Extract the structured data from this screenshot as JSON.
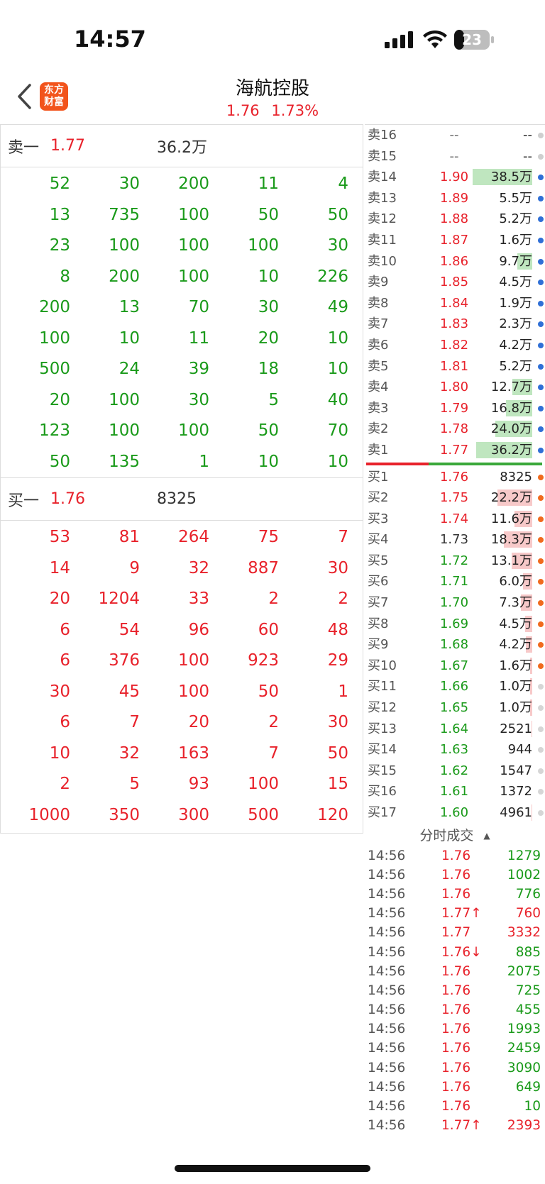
{
  "status": {
    "time": "14:57",
    "battery": "23"
  },
  "nav": {
    "logo_line1": "东方",
    "logo_line2": "财富",
    "stock_name": "海航控股",
    "price": "1.76",
    "change_pct": "1.73%"
  },
  "sell_one": {
    "label": "卖一",
    "price": "1.77",
    "volume": "36.2万"
  },
  "sell_grid": [
    [
      "52",
      "30",
      "200",
      "11",
      "4"
    ],
    [
      "13",
      "735",
      "100",
      "50",
      "50"
    ],
    [
      "23",
      "100",
      "100",
      "100",
      "30"
    ],
    [
      "8",
      "200",
      "100",
      "10",
      "226"
    ],
    [
      "200",
      "13",
      "70",
      "30",
      "49"
    ],
    [
      "100",
      "10",
      "11",
      "20",
      "10"
    ],
    [
      "500",
      "24",
      "39",
      "18",
      "10"
    ],
    [
      "20",
      "100",
      "30",
      "5",
      "40"
    ],
    [
      "123",
      "100",
      "100",
      "50",
      "70"
    ],
    [
      "50",
      "135",
      "1",
      "10",
      "10"
    ]
  ],
  "buy_one": {
    "label": "买一",
    "price": "1.76",
    "volume": "8325"
  },
  "buy_grid": [
    [
      "53",
      "81",
      "264",
      "75",
      "7"
    ],
    [
      "14",
      "9",
      "32",
      "887",
      "30"
    ],
    [
      "20",
      "1204",
      "33",
      "2",
      "2"
    ],
    [
      "6",
      "54",
      "96",
      "60",
      "48"
    ],
    [
      "6",
      "376",
      "100",
      "923",
      "29"
    ],
    [
      "30",
      "45",
      "100",
      "50",
      "1"
    ],
    [
      "6",
      "7",
      "20",
      "2",
      "30"
    ],
    [
      "10",
      "32",
      "163",
      "7",
      "50"
    ],
    [
      "2",
      "5",
      "93",
      "100",
      "15"
    ],
    [
      "1000",
      "350",
      "300",
      "500",
      "120"
    ]
  ],
  "asks": [
    {
      "label": "卖16",
      "price": "--",
      "volume": "--",
      "price_color": "gray",
      "bar": 0,
      "dot": "#cfcfcf"
    },
    {
      "label": "卖15",
      "price": "--",
      "volume": "--",
      "price_color": "gray",
      "bar": 0,
      "dot": "#cfcfcf"
    },
    {
      "label": "卖14",
      "price": "1.90",
      "volume": "38.5万",
      "price_color": "red",
      "bar": 1.0,
      "dot": "#2f6fd6"
    },
    {
      "label": "卖13",
      "price": "1.89",
      "volume": "5.5万",
      "price_color": "red",
      "bar": 0.0,
      "dot": "#2f6fd6"
    },
    {
      "label": "卖12",
      "price": "1.88",
      "volume": "5.2万",
      "price_color": "red",
      "bar": 0.0,
      "dot": "#2f6fd6"
    },
    {
      "label": "卖11",
      "price": "1.87",
      "volume": "1.6万",
      "price_color": "red",
      "bar": 0.0,
      "dot": "#2f6fd6"
    },
    {
      "label": "卖10",
      "price": "1.86",
      "volume": "9.7万",
      "price_color": "red",
      "bar": 0.25,
      "dot": "#2f6fd6"
    },
    {
      "label": "卖9",
      "price": "1.85",
      "volume": "4.5万",
      "price_color": "red",
      "bar": 0.0,
      "dot": "#2f6fd6"
    },
    {
      "label": "卖8",
      "price": "1.84",
      "volume": "1.9万",
      "price_color": "red",
      "bar": 0.0,
      "dot": "#2f6fd6"
    },
    {
      "label": "卖7",
      "price": "1.83",
      "volume": "2.3万",
      "price_color": "red",
      "bar": 0.0,
      "dot": "#2f6fd6"
    },
    {
      "label": "卖6",
      "price": "1.82",
      "volume": "4.2万",
      "price_color": "red",
      "bar": 0.0,
      "dot": "#2f6fd6"
    },
    {
      "label": "卖5",
      "price": "1.81",
      "volume": "5.2万",
      "price_color": "red",
      "bar": 0.0,
      "dot": "#2f6fd6"
    },
    {
      "label": "卖4",
      "price": "1.80",
      "volume": "12.7万",
      "price_color": "red",
      "bar": 0.33,
      "dot": "#2f6fd6"
    },
    {
      "label": "卖3",
      "price": "1.79",
      "volume": "16.8万",
      "price_color": "red",
      "bar": 0.44,
      "dot": "#2f6fd6"
    },
    {
      "label": "卖2",
      "price": "1.78",
      "volume": "24.0万",
      "price_color": "red",
      "bar": 0.62,
      "dot": "#2f6fd6"
    },
    {
      "label": "卖1",
      "price": "1.77",
      "volume": "36.2万",
      "price_color": "red",
      "bar": 0.94,
      "dot": "#2f6fd6"
    }
  ],
  "bids": [
    {
      "label": "买1",
      "price": "1.76",
      "volume": "8325",
      "price_color": "red",
      "bar": 0.0,
      "dot": "#f06a1d"
    },
    {
      "label": "买2",
      "price": "1.75",
      "volume": "22.2万",
      "price_color": "red",
      "bar": 0.58,
      "dot": "#f06a1d"
    },
    {
      "label": "买3",
      "price": "1.74",
      "volume": "11.6万",
      "price_color": "red",
      "bar": 0.3,
      "dot": "#f06a1d"
    },
    {
      "label": "买4",
      "price": "1.73",
      "volume": "18.3万",
      "price_color": "dark",
      "bar": 0.48,
      "dot": "#f06a1d"
    },
    {
      "label": "买5",
      "price": "1.72",
      "volume": "13.1万",
      "price_color": "green",
      "bar": 0.34,
      "dot": "#f06a1d"
    },
    {
      "label": "买6",
      "price": "1.71",
      "volume": "6.0万",
      "price_color": "green",
      "bar": 0.16,
      "dot": "#f06a1d"
    },
    {
      "label": "买7",
      "price": "1.70",
      "volume": "7.3万",
      "price_color": "green",
      "bar": 0.19,
      "dot": "#f06a1d"
    },
    {
      "label": "买8",
      "price": "1.69",
      "volume": "4.5万",
      "price_color": "green",
      "bar": 0.12,
      "dot": "#f06a1d"
    },
    {
      "label": "买9",
      "price": "1.68",
      "volume": "4.2万",
      "price_color": "green",
      "bar": 0.11,
      "dot": "#f06a1d"
    },
    {
      "label": "买10",
      "price": "1.67",
      "volume": "1.6万",
      "price_color": "green",
      "bar": 0.04,
      "dot": "#f06a1d"
    },
    {
      "label": "买11",
      "price": "1.66",
      "volume": "1.0万",
      "price_color": "green",
      "bar": 0.03,
      "dot": "#d6d6d6"
    },
    {
      "label": "买12",
      "price": "1.65",
      "volume": "1.0万",
      "price_color": "green",
      "bar": 0.03,
      "dot": "#d6d6d6"
    },
    {
      "label": "买13",
      "price": "1.64",
      "volume": "2521",
      "price_color": "green",
      "bar": 0.01,
      "dot": "#d6d6d6"
    },
    {
      "label": "买14",
      "price": "1.63",
      "volume": "944",
      "price_color": "green",
      "bar": 0.0,
      "dot": "#d6d6d6"
    },
    {
      "label": "买15",
      "price": "1.62",
      "volume": "1547",
      "price_color": "green",
      "bar": 0.0,
      "dot": "#d6d6d6"
    },
    {
      "label": "买16",
      "price": "1.61",
      "volume": "1372",
      "price_color": "green",
      "bar": 0.0,
      "dot": "#d6d6d6"
    },
    {
      "label": "买17",
      "price": "1.60",
      "volume": "4961",
      "price_color": "green",
      "bar": 0.01,
      "dot": "#d6d6d6"
    }
  ],
  "ticks_header": {
    "label": "分时成交",
    "arrow": "▲"
  },
  "ticks": [
    {
      "time": "14:56",
      "price": "1.76",
      "volume": "1279",
      "vol_color": "green"
    },
    {
      "time": "14:56",
      "price": "1.76",
      "volume": "1002",
      "vol_color": "green"
    },
    {
      "time": "14:56",
      "price": "1.76",
      "volume": "776",
      "vol_color": "green"
    },
    {
      "time": "14:56",
      "price": "1.77↑",
      "volume": "760",
      "vol_color": "red"
    },
    {
      "time": "14:56",
      "price": "1.77",
      "volume": "3332",
      "vol_color": "red"
    },
    {
      "time": "14:56",
      "price": "1.76↓",
      "volume": "885",
      "vol_color": "green"
    },
    {
      "time": "14:56",
      "price": "1.76",
      "volume": "2075",
      "vol_color": "green"
    },
    {
      "time": "14:56",
      "price": "1.76",
      "volume": "725",
      "vol_color": "green"
    },
    {
      "time": "14:56",
      "price": "1.76",
      "volume": "455",
      "vol_color": "green"
    },
    {
      "time": "14:56",
      "price": "1.76",
      "volume": "1993",
      "vol_color": "green"
    },
    {
      "time": "14:56",
      "price": "1.76",
      "volume": "2459",
      "vol_color": "green"
    },
    {
      "time": "14:56",
      "price": "1.76",
      "volume": "3090",
      "vol_color": "green"
    },
    {
      "time": "14:56",
      "price": "1.76",
      "volume": "649",
      "vol_color": "green"
    },
    {
      "time": "14:56",
      "price": "1.76",
      "volume": "10",
      "vol_color": "green"
    },
    {
      "time": "14:56",
      "price": "1.77↑",
      "volume": "2393",
      "vol_color": "red"
    }
  ]
}
